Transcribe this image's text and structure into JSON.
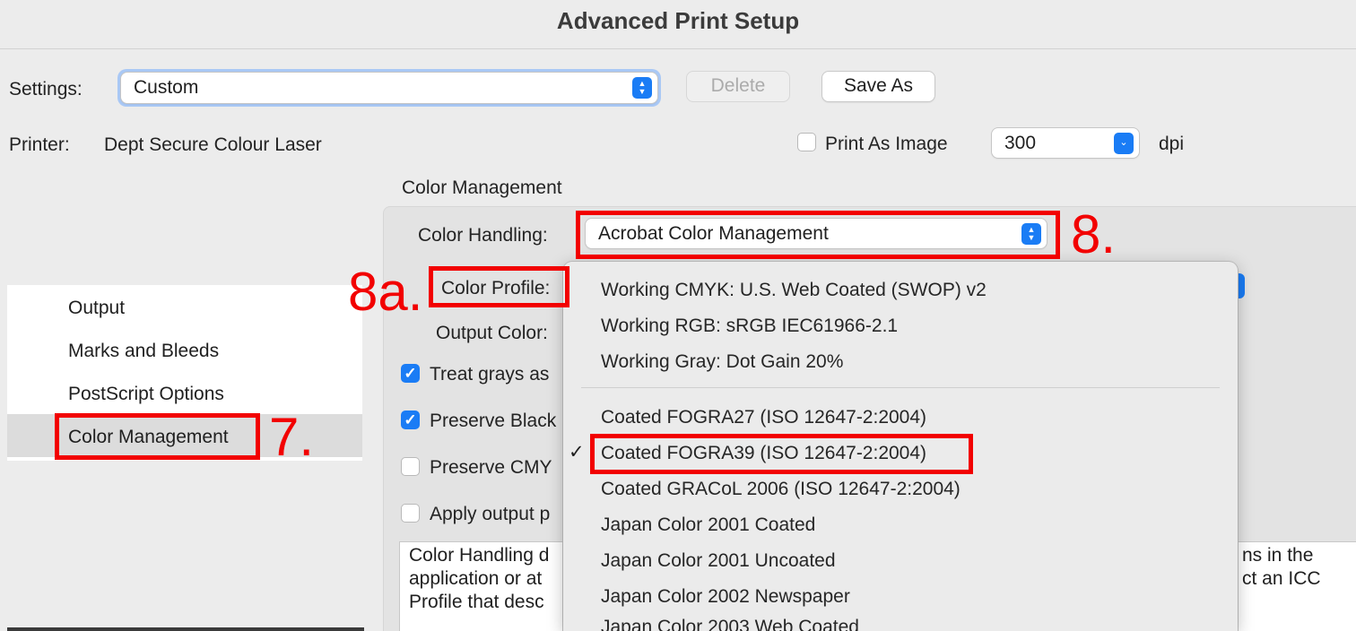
{
  "window": {
    "title": "Advanced Print Setup"
  },
  "settings": {
    "label": "Settings:",
    "value": "Custom",
    "delete_label": "Delete",
    "save_as_label": "Save As"
  },
  "printer": {
    "label": "Printer:",
    "value": "Dept Secure Colour Laser"
  },
  "print_as_image": {
    "label": "Print As Image",
    "checked": false,
    "dpi_value": "300",
    "dpi_unit": "dpi"
  },
  "sidebar": {
    "items": [
      {
        "label": "Output"
      },
      {
        "label": "Marks and Bleeds"
      },
      {
        "label": "PostScript Options"
      },
      {
        "label": "Color Management",
        "selected": true
      }
    ]
  },
  "color_management": {
    "section_title": "Color Management",
    "color_handling_label": "Color Handling:",
    "color_handling_value": "Acrobat Color Management",
    "color_profile_label": "Color Profile:",
    "output_color_label": "Output Color:",
    "options": [
      {
        "label": "Treat grays as",
        "checked": true
      },
      {
        "label": "Preserve Black",
        "checked": true
      },
      {
        "label": "Preserve CMY",
        "checked": false
      },
      {
        "label": "Apply output p",
        "checked": false
      }
    ],
    "description_lines": [
      "Color Handling d",
      "application or at",
      "Profile that desc"
    ],
    "description_right_lines": [
      "ns in the",
      "ct an ICC"
    ]
  },
  "profile_menu": {
    "group1": [
      "Working CMYK: U.S. Web Coated (SWOP) v2",
      "Working RGB: sRGB IEC61966-2.1",
      "Working Gray: Dot Gain 20%"
    ],
    "group2": [
      "Coated FOGRA27 (ISO 12647-2:2004)",
      "Coated FOGRA39 (ISO 12647-2:2004)",
      "Coated GRACoL 2006 (ISO 12647-2:2004)",
      "Japan Color 2001 Coated",
      "Japan Color 2001 Uncoated",
      "Japan Color 2002 Newspaper",
      "Japan Color 2003 Web Coated"
    ],
    "selected": "Coated FOGRA39 (ISO 12647-2:2004)",
    "check_mark": "✓"
  },
  "annotations": {
    "step7": "7.",
    "step8": "8.",
    "step8a": "8a.",
    "color": "#f20000"
  },
  "colors": {
    "accent": "#1a7cf5",
    "background": "#ececec"
  }
}
